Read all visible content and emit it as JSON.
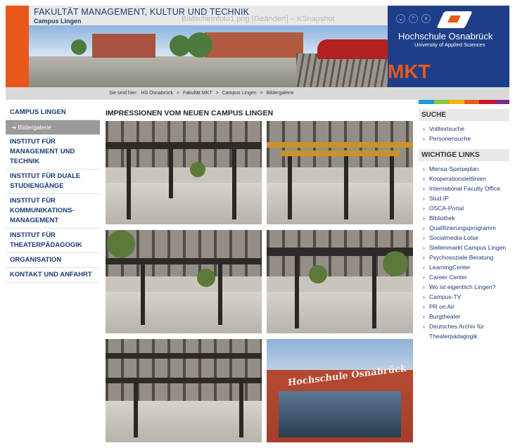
{
  "header": {
    "faculty_title": "FAKULTÄT MANAGEMENT, KULTUR UND TECHNIK",
    "campus_subtitle": "Campus Lingen",
    "window_caption": "Bildschirmfoto1.png [Geändert] – KSnapshot",
    "logo_name": "Hochschule Osnabrück",
    "logo_subtitle": "University of Applied Sciences",
    "mkt_label": "MKT"
  },
  "breadcrumb": {
    "prefix": "Sie sind hier:",
    "items": [
      "HS Osnabrück",
      "Fakultät MKT",
      "Campus Lingen",
      "Bildergalerie"
    ],
    "separator": ">"
  },
  "colors": {
    "accent_orange": "#e8581a",
    "brand_blue": "#1e3f88",
    "link_blue": "#1a3b78",
    "strip": [
      "#1b9bd7",
      "#8cc63f",
      "#f2b705",
      "#e8581a",
      "#c4171d",
      "#7b2a8c"
    ]
  },
  "left_nav": {
    "items": [
      {
        "label": "CAMPUS LINGEN",
        "sub": false
      },
      {
        "label": "➔ Bildergalerie",
        "sub": true
      },
      {
        "label": "INSTITUT FÜR MANAGEMENT UND TECHNIK",
        "sub": false
      },
      {
        "label": "INSTITUT FÜR DUALE STUDIENGÄNGE",
        "sub": false
      },
      {
        "label": "INSTITUT FÜR KOMMUNIKATIONS-MANAGEMENT",
        "sub": false
      },
      {
        "label": "INSTITUT FÜR THEATERPÄDAGOGIK",
        "sub": false
      },
      {
        "label": "ORGANISATION",
        "sub": false
      },
      {
        "label": "KONTAKT UND ANFAHRT",
        "sub": false
      }
    ]
  },
  "main": {
    "heading": "IMPRESSIONEN VOM NEUEN CAMPUS LINGEN",
    "photos": [
      "hall-interior-photo",
      "crane-hall-photo",
      "hall-trees-photo",
      "hall-walkway-photo",
      "roof-structure-photo",
      "hochschule-facade-photo"
    ],
    "facade_sign": "Hochschule Osnabrück"
  },
  "right": {
    "suche_heading": "SUCHE",
    "suche_links": [
      "Volltextsuche",
      "Personensuche"
    ],
    "links_heading": "WICHTIGE LINKS",
    "links": [
      "Mensa-Speiseplan",
      "Kooperationsleitlinien",
      "International Faculty Office",
      "Stud.IP",
      "OSCA-Portal",
      "Bibliothek",
      "Qualifizierungsprogramm",
      "Socialmedia-Lotse",
      "Stellenmarkt Campus Lingen",
      "Psychosoziale Beratung",
      "LearningCenter",
      "Career Center",
      "Wo ist eigentlich Lingen?",
      "Campus-TV",
      "PR on Air",
      "Burgtheater",
      "Deutsches Archiv für Theaterpädagogik"
    ]
  }
}
